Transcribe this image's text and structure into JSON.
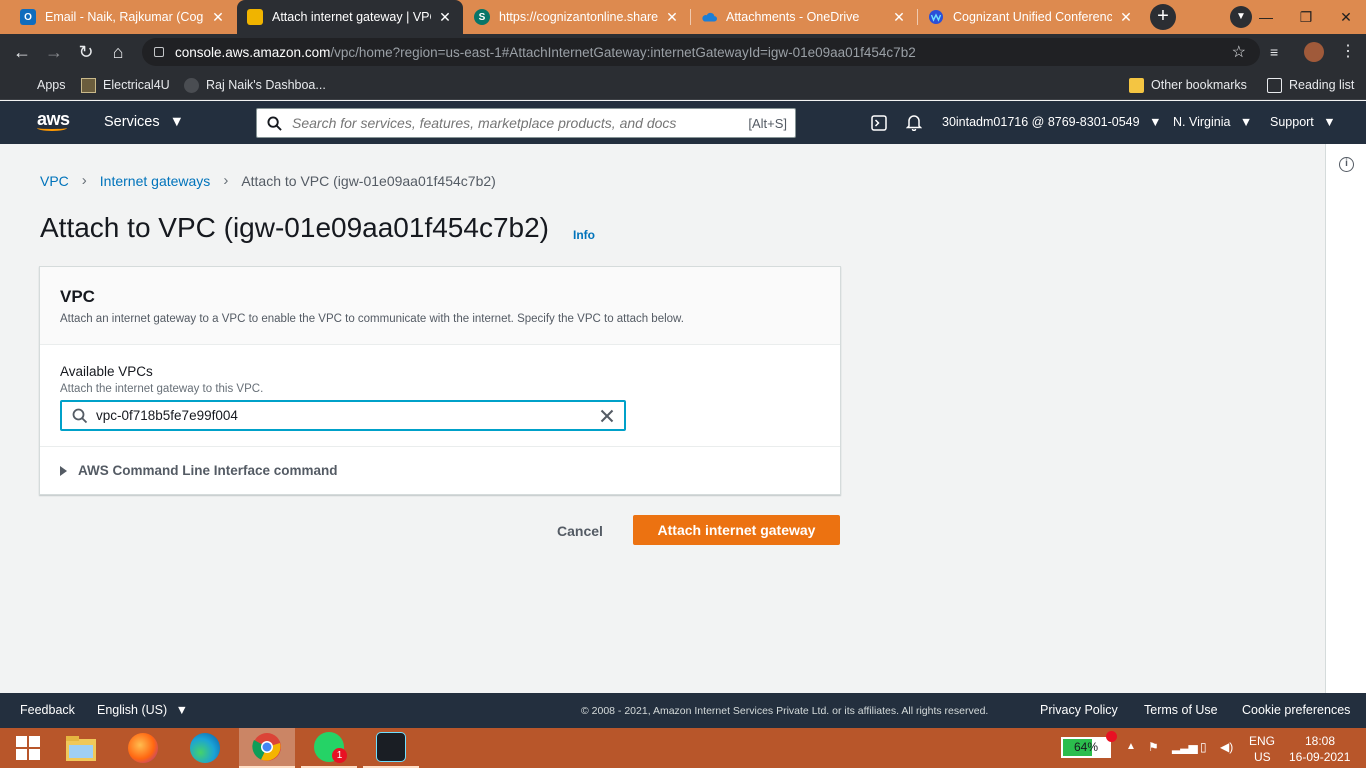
{
  "browser": {
    "tabs": [
      {
        "title": "Email - Naik, Rajkumar (Cogniz",
        "favicon_color": "#0f6cbd",
        "favicon_glyph": "O"
      },
      {
        "title": "Attach internet gateway | VPC M",
        "favicon_color": "#f0b400",
        "favicon_glyph": ""
      },
      {
        "title": "https://cognizantonline.sharepo",
        "favicon_color": "#077568",
        "favicon_glyph": "S"
      },
      {
        "title": "Attachments - OneDrive",
        "favicon_color": "#1c7ed6",
        "favicon_glyph": ""
      },
      {
        "title": "Cognizant Unified Conferencing",
        "favicon_color": "#2b4fd8",
        "favicon_glyph": ""
      }
    ],
    "url_host": "console.aws.amazon.com",
    "url_path": "/vpc/home?region=us-east-1#AttachInternetGateway:internetGatewayId=igw-01e09aa01f454c7b2",
    "bookmarks": [
      "Apps",
      "Electrical4U",
      "Raj Naik's Dashboa..."
    ],
    "bookmarks_right": [
      "Other bookmarks",
      "Reading list"
    ]
  },
  "aws_nav": {
    "logo": "aws",
    "services": "Services",
    "search_placeholder": "Search for services, features, marketplace products, and docs",
    "search_shortcut": "[Alt+S]",
    "account": "30intadm01716 @ 8769-8301-0549",
    "region": "N. Virginia",
    "support": "Support"
  },
  "breadcrumb": {
    "items": [
      "VPC",
      "Internet gateways"
    ],
    "current": "Attach to VPC (igw-01e09aa01f454c7b2)"
  },
  "page": {
    "title": "Attach to VPC (igw-01e09aa01f454c7b2)",
    "info": "Info"
  },
  "panel": {
    "title": "VPC",
    "description": "Attach an internet gateway to a VPC to enable the VPC to communicate with the internet. Specify the VPC to attach below.",
    "field_label": "Available VPCs",
    "field_description": "Attach the internet gateway to this VPC.",
    "field_value": "vpc-0f718b5fe7e99f004",
    "cli_label": "AWS Command Line Interface command"
  },
  "actions": {
    "cancel": "Cancel",
    "attach": "Attach internet gateway"
  },
  "footer": {
    "feedback": "Feedback",
    "language": "English (US)",
    "copyright": "© 2008 - 2021, Amazon Internet Services Private Ltd. or its affiliates. All rights reserved.",
    "privacy": "Privacy Policy",
    "terms": "Terms of Use",
    "cookies": "Cookie preferences"
  },
  "taskbar": {
    "battery": "64%",
    "battery_level": 0.64,
    "whatsapp_badge": "1",
    "lang_top": "ENG",
    "lang_bottom": "US",
    "time": "18:08",
    "date": "16-09-2021"
  },
  "colors": {
    "aws_nav": "#232f3e",
    "primary_button": "#ec7211",
    "link": "#0073bb",
    "focus": "#00a1c9",
    "chrome_frame": "#dd8a4f",
    "taskbar": "#b8562a"
  }
}
